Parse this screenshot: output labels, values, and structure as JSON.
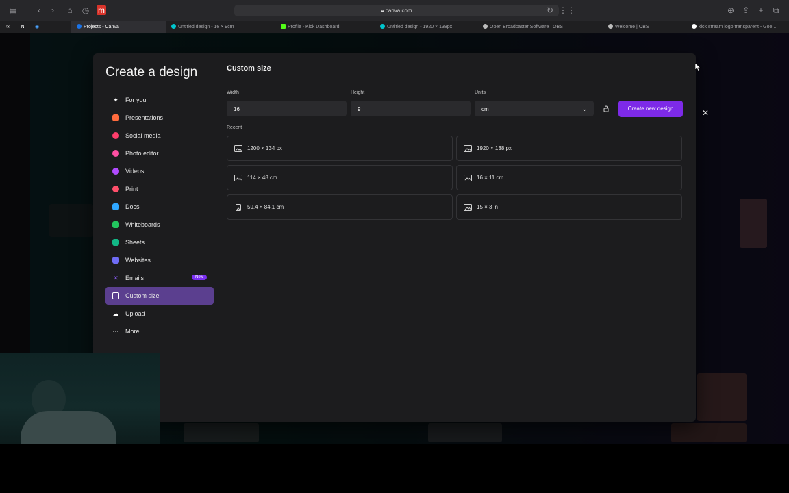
{
  "browser": {
    "address": "canva.com",
    "tabs": [
      {
        "label": "Projects - Canva",
        "active": true,
        "color": "#1a73e8"
      },
      {
        "label": "Untitled design - 16 × 9cm",
        "active": false,
        "color": "#00c4cc"
      },
      {
        "label": "Profile - Kick Dashboard",
        "active": false,
        "color": "#53fc18"
      },
      {
        "label": "Untitled design - 1920 × 138px",
        "active": false,
        "color": "#00c4cc"
      },
      {
        "label": "Open Broadcaster Software | OBS",
        "active": false,
        "color": "#bbbbbb"
      },
      {
        "label": "Welcome | OBS",
        "active": false,
        "color": "#bbbbbb"
      },
      {
        "label": "kick stream logo transparent - Goo...",
        "active": false,
        "color": "#ffffff"
      }
    ]
  },
  "modal": {
    "title": "Create a design",
    "close_icon": "close-icon",
    "nav": [
      {
        "label": "For you",
        "icon": "sparkle-icon",
        "color": "#ffffff"
      },
      {
        "label": "Presentations",
        "icon": "presentation-icon",
        "color": "#ff6b3d"
      },
      {
        "label": "Social media",
        "icon": "heart-icon",
        "color": "#ff3d6b"
      },
      {
        "label": "Photo editor",
        "icon": "photo-editor-icon",
        "color": "#ff4fa3"
      },
      {
        "label": "Videos",
        "icon": "video-icon",
        "color": "#b14bff"
      },
      {
        "label": "Print",
        "icon": "print-icon",
        "color": "#ff4f6b"
      },
      {
        "label": "Docs",
        "icon": "docs-icon",
        "color": "#2fa6ff"
      },
      {
        "label": "Whiteboards",
        "icon": "whiteboard-icon",
        "color": "#22c55e"
      },
      {
        "label": "Sheets",
        "icon": "sheets-icon",
        "color": "#12b886"
      },
      {
        "label": "Websites",
        "icon": "website-icon",
        "color": "#6f6cf5"
      },
      {
        "label": "Emails",
        "icon": "email-icon",
        "color": "#8b5cf6",
        "badge": "New"
      },
      {
        "label": "Custom size",
        "icon": "custom-size-icon",
        "color": "#ffffff",
        "active": true
      },
      {
        "label": "Upload",
        "icon": "upload-icon",
        "color": "#ffffff"
      },
      {
        "label": "More",
        "icon": "more-icon",
        "color": "#ffffff"
      }
    ],
    "custom": {
      "title": "Custom size",
      "width_label": "Width",
      "width_value": "16",
      "height_label": "Height",
      "height_value": "9",
      "units_label": "Units",
      "units_value": "cm",
      "create_button": "Create new design",
      "recent_label": "Recent",
      "recent": [
        {
          "label": "1200 × 134 px",
          "icon": "image-icon"
        },
        {
          "label": "1920 × 138 px",
          "icon": "image-icon"
        },
        {
          "label": "114 × 48 cm",
          "icon": "image-icon"
        },
        {
          "label": "16 × 11 cm",
          "icon": "image-icon"
        },
        {
          "label": "59.4 × 84.1 cm",
          "icon": "portrait-image-icon"
        },
        {
          "label": "15 × 3 in",
          "icon": "image-icon"
        }
      ]
    }
  },
  "colors": {
    "accent": "#7d2ae8",
    "nav_active": "#5b3f8f",
    "badge": "#7b2ff2"
  }
}
